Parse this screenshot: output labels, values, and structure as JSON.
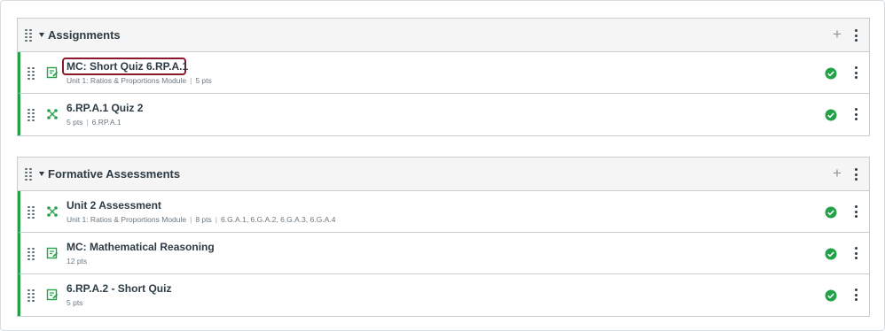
{
  "groups": [
    {
      "title": "Assignments",
      "items": [
        {
          "title": "MC: Short Quiz 6.RP.A.1",
          "meta": [
            "Unit 1: Ratios & Proportions Module",
            "5 pts"
          ],
          "type_icon": "assignment-icon",
          "status": "published"
        },
        {
          "title": "6.RP.A.1 Quiz 2",
          "meta": [
            "5 pts",
            "6.RP.A.1"
          ],
          "type_icon": "quiz-icon",
          "status": "published"
        }
      ]
    },
    {
      "title": "Formative Assessments",
      "items": [
        {
          "title": "Unit 2 Assessment",
          "meta": [
            "Unit 1: Ratios & Proportions Module",
            "8 pts",
            "6.G.A.1, 6.G.A.2, 6.G.A.3, 6.G.A.4"
          ],
          "type_icon": "quiz-icon",
          "status": "published"
        },
        {
          "title": "MC: Mathematical Reasoning",
          "meta": [
            "12 pts"
          ],
          "type_icon": "assignment-icon",
          "status": "published"
        },
        {
          "title": "6.RP.A.2 - Short Quiz",
          "meta": [
            "5 pts"
          ],
          "type_icon": "assignment-icon",
          "status": "published"
        }
      ]
    }
  ],
  "icons": {
    "add": "plus-icon",
    "menu": "kebab-menu-icon",
    "drag": "drag-handle-icon",
    "collapse": "caret-down-icon",
    "status": "published-check-icon"
  },
  "colors": {
    "published": "#23a148",
    "highlight": "#8a1a2b",
    "header_bg": "#f5f5f5"
  }
}
